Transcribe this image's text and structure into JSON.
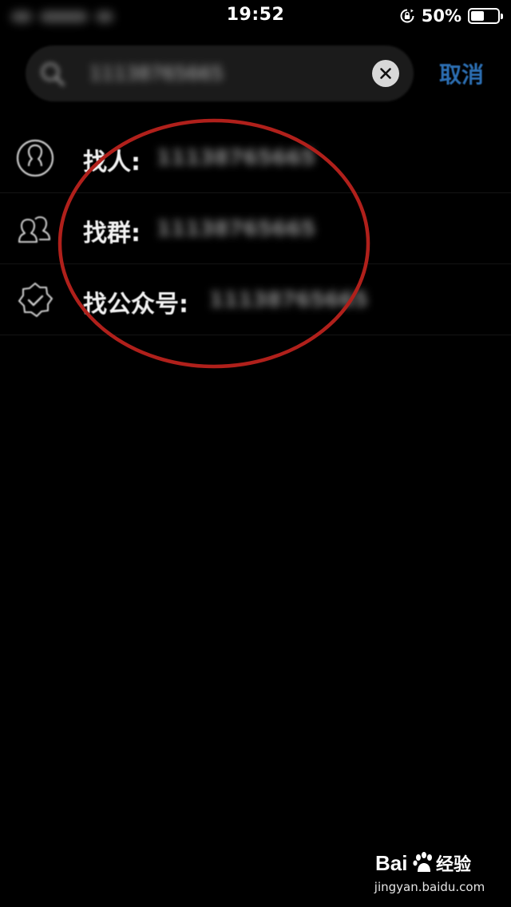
{
  "status_bar": {
    "time": "19:52",
    "battery_percent": "50%",
    "battery_level": 0.5
  },
  "search": {
    "query": "11138765665",
    "clear_icon": "close-icon"
  },
  "cancel_label": "取消",
  "results": [
    {
      "icon": "person-icon",
      "label": "找人:",
      "query": "11138765665"
    },
    {
      "icon": "group-icon",
      "label": "找群:",
      "query": "11138765665"
    },
    {
      "icon": "verified-badge-icon",
      "label": "找公众号:",
      "query": "11138765665"
    }
  ],
  "annotation": {
    "color": "#b0201b"
  },
  "watermark": {
    "brand": "Bai 经验",
    "url": "jingyan.baidu.com"
  },
  "colors": {
    "background": "#000000",
    "accent": "#2c6fb3"
  }
}
